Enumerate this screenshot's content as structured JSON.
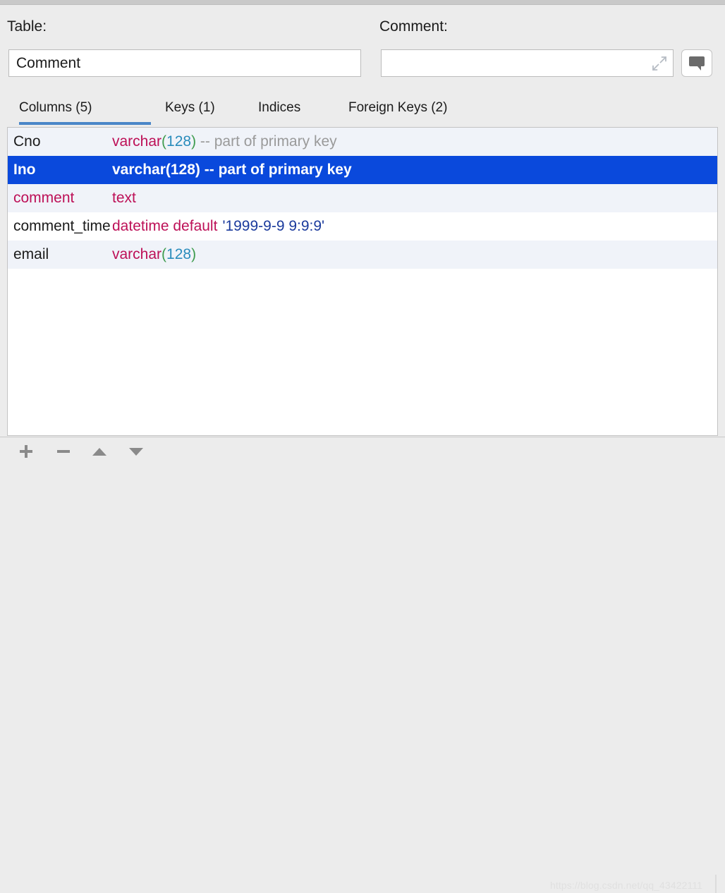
{
  "window": {
    "chrome_color": "#c9c9c9",
    "panel_bg": "#ececec"
  },
  "header": {
    "table_label": "Table:",
    "comment_label": "Comment:",
    "table_value": "Comment",
    "table_placeholder": "",
    "comment_value": "",
    "comment_placeholder": "",
    "expand_icon_name": "expand-icon",
    "bubble_button_name": "comment-bubble-button"
  },
  "tabs": {
    "active_index": 0,
    "accent_color": "#4a86c8",
    "items": [
      {
        "label": "Columns (5)"
      },
      {
        "label": "Keys (1)"
      },
      {
        "label": "Indices"
      },
      {
        "label": "Foreign Keys (2)"
      }
    ]
  },
  "columns": {
    "selection_color": "#0a49dc",
    "rows": [
      {
        "name": "Cno",
        "type": "varchar",
        "open_paren": "(",
        "length": "128",
        "close_paren": ")",
        "trailing": " -- part of primary key"
      },
      {
        "name": "Ino",
        "type": "varchar(128) -- part of primary key",
        "open_paren": "",
        "length": "",
        "close_paren": "",
        "trailing": ""
      },
      {
        "name": "comment",
        "type": "text",
        "open_paren": "",
        "length": "",
        "close_paren": "",
        "trailing": ""
      },
      {
        "name": "comment_time",
        "type": "datetime default",
        "open_paren": "",
        "length": "",
        "close_paren": "",
        "trailing": "",
        "default_value": "'1999-9-9 9:9:9'"
      },
      {
        "name": "email",
        "type": "varchar",
        "open_paren": "(",
        "length": "128",
        "close_paren": ")",
        "trailing": ""
      }
    ]
  },
  "toolbar": {
    "add_label": "+",
    "remove_label": "−",
    "move_up_label": "▲",
    "move_down_label": "▼"
  },
  "watermark": {
    "text": "https://blog.csdn.net/qq_43422111"
  }
}
